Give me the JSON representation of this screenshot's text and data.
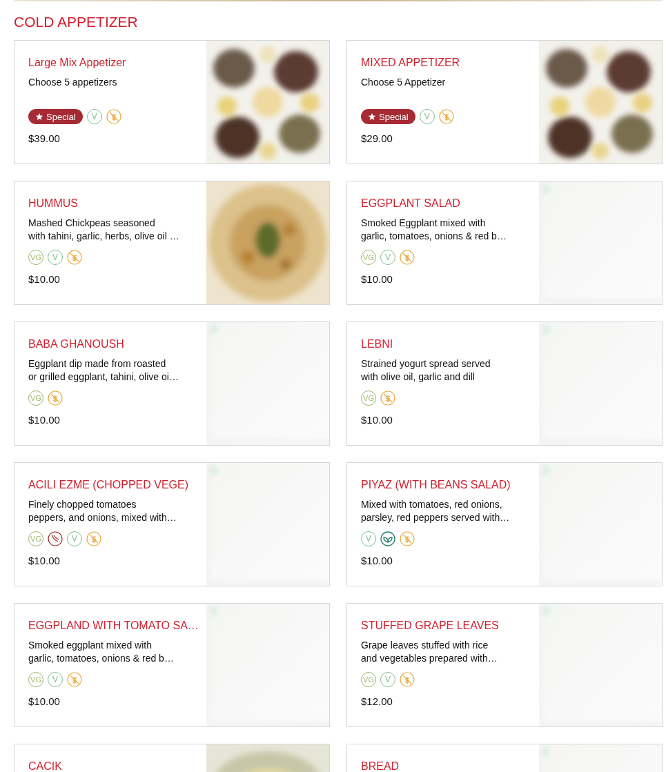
{
  "section_title": "COLD APPETIZER",
  "items": [
    {
      "title": "Large Mix Appetizer",
      "description": "Choose 5 appetizers",
      "tags": [
        {
          "kind": "special",
          "label": "Special"
        },
        {
          "kind": "v",
          "label": "V"
        },
        {
          "kind": "gluten"
        }
      ],
      "price": "$39.00"
    },
    {
      "title": "MIXED APPETIZER",
      "description": "Choose 5 Appetizer",
      "tags": [
        {
          "kind": "special",
          "label": "Special"
        },
        {
          "kind": "v",
          "label": "V"
        },
        {
          "kind": "gluten"
        }
      ],
      "price": "$29.00"
    },
    {
      "title": "HUMMUS",
      "description": "Mashed Chickpeas seasoned\nwith tahini, garlic, herbs, olive oil …",
      "tags": [
        {
          "kind": "vg",
          "label": "VG"
        },
        {
          "kind": "v",
          "label": "V"
        },
        {
          "kind": "gluten"
        }
      ],
      "price": "$10.00"
    },
    {
      "title": "EGGPLANT SALAD",
      "description": "Smoked Eggplant mixed with\ngarlic, tomatoes, onions & red b…",
      "tags": [
        {
          "kind": "vg",
          "label": "VG"
        },
        {
          "kind": "v",
          "label": "V"
        },
        {
          "kind": "gluten"
        }
      ],
      "price": "$10.00"
    },
    {
      "title": "BABA GHANOUSH",
      "description": "Eggplant dip made from roasted\nor grilled eggplant, tahini, olive oi…",
      "tags": [
        {
          "kind": "vg",
          "label": "VG"
        },
        {
          "kind": "gluten"
        }
      ],
      "price": "$10.00"
    },
    {
      "title": "LEBNI",
      "description": "Strained yogurt spread served\nwith olive oil, garlic and dill",
      "tags": [
        {
          "kind": "vg",
          "label": "VG"
        },
        {
          "kind": "gluten"
        }
      ],
      "price": "$10.00"
    },
    {
      "title": "ACILI EZME (CHOPPED VEGE)",
      "description": "Finely chopped tomatoes\npeppers, and onions, mixed with…",
      "tags": [
        {
          "kind": "vg",
          "label": "VG"
        },
        {
          "kind": "spicy"
        },
        {
          "kind": "v",
          "label": "V"
        },
        {
          "kind": "gluten"
        }
      ],
      "price": "$10.00"
    },
    {
      "title": "PIYAZ (WITH BEANS SALAD)",
      "description": "Mixed with tomatoes, red onions,\nparsley, red peppers served with…",
      "tags": [
        {
          "kind": "v",
          "label": "V"
        },
        {
          "kind": "vegan"
        },
        {
          "kind": "gluten"
        }
      ],
      "price": "$10.00"
    },
    {
      "title": "EGGPLAND WITH TOMATO SA…",
      "description": "Smoked eggplant mixed with\ngarlic, tomatoes, onions & red b…",
      "tags": [
        {
          "kind": "vg",
          "label": "VG"
        },
        {
          "kind": "v",
          "label": "V"
        },
        {
          "kind": "gluten"
        }
      ],
      "price": "$10.00"
    },
    {
      "title": "STUFFED GRAPE LEAVES",
      "description": "Grape leaves stuffed with rice\nand vegetables prepared with…",
      "tags": [
        {
          "kind": "vg",
          "label": "VG"
        },
        {
          "kind": "v",
          "label": "V"
        },
        {
          "kind": "gluten"
        }
      ],
      "price": "$12.00"
    },
    {
      "title": "CACIK"
    },
    {
      "title": "BREAD"
    }
  ]
}
